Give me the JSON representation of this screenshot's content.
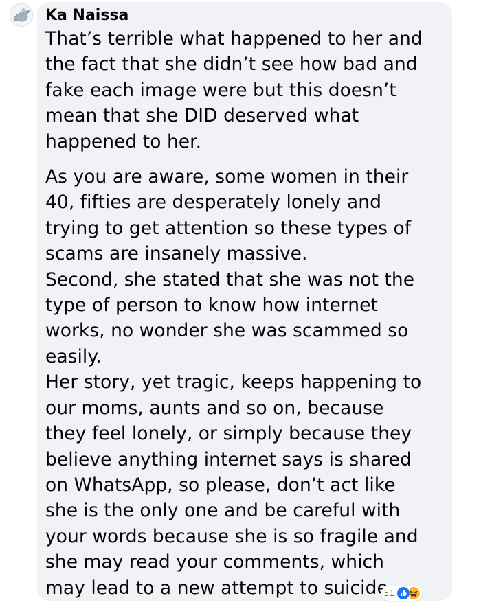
{
  "comment": {
    "author": "Ka Naissa",
    "paragraphs": [
      {
        "lines": [
          "That’s terrible what happened to her and",
          "the fact that she didn’t see how bad and",
          "fake each image were but this doesn’t",
          "mean that she DID deserved what",
          "happened to her."
        ]
      },
      {
        "lines": [
          "As you are aware, some women in their",
          "40, fifties are desperately lonely and",
          "trying to get attention so these types of",
          "scams are insanely massive."
        ]
      },
      {
        "lines": [
          "Second, she stated that she was not the",
          "type of person to know how internet",
          "works, no wonder she was scammed so",
          "easily."
        ]
      },
      {
        "lines": [
          "Her story, yet tragic, keeps happening to",
          "our moms, aunts and so on, because",
          "they feel lonely, or simply because they",
          "believe anything internet says is shared",
          "on WhatsApp, so please, don’t act like",
          "she is the only one and be careful with",
          "your words because she is so fragile and",
          "she may read your comments, which",
          "may lead to a new attempt to suicide."
        ]
      }
    ],
    "reactions": {
      "count": "51",
      "icons": [
        "like-icon",
        "haha-icon"
      ],
      "colors": {
        "like": "#1877f2",
        "haha": "#f7b928"
      }
    },
    "avatar_icon": "dove-icon",
    "bubble_color": "#f0f2f5"
  }
}
